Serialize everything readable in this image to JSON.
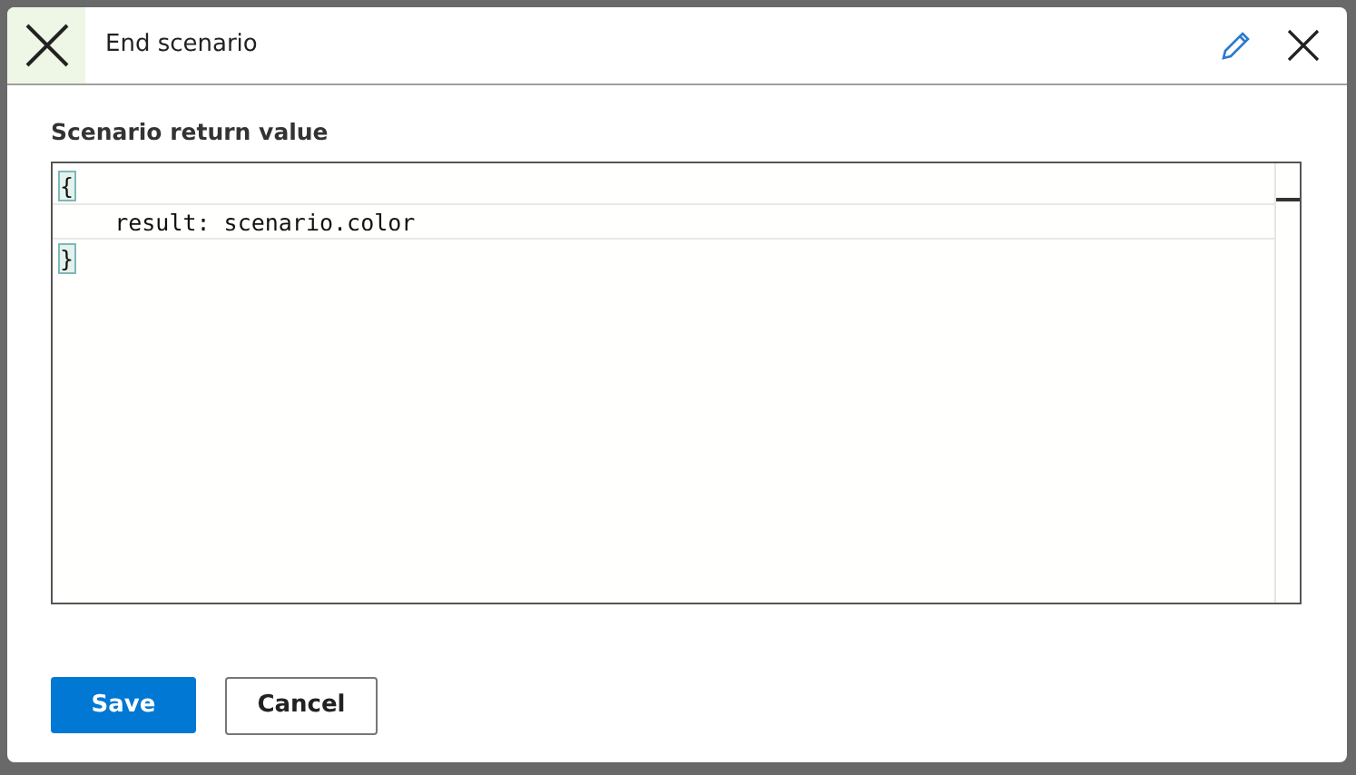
{
  "dialog": {
    "title": "End scenario"
  },
  "field": {
    "label": "Scenario return value",
    "lines": [
      {
        "text": "{",
        "selected": false,
        "bracket_match": true
      },
      {
        "text": "    result: scenario.color",
        "selected": true,
        "bracket_match": false
      },
      {
        "text": "}",
        "selected": false,
        "bracket_match": true
      }
    ]
  },
  "buttons": [
    {
      "label": "Save",
      "kind": "primary"
    },
    {
      "label": "Cancel",
      "kind": "secondary"
    }
  ]
}
